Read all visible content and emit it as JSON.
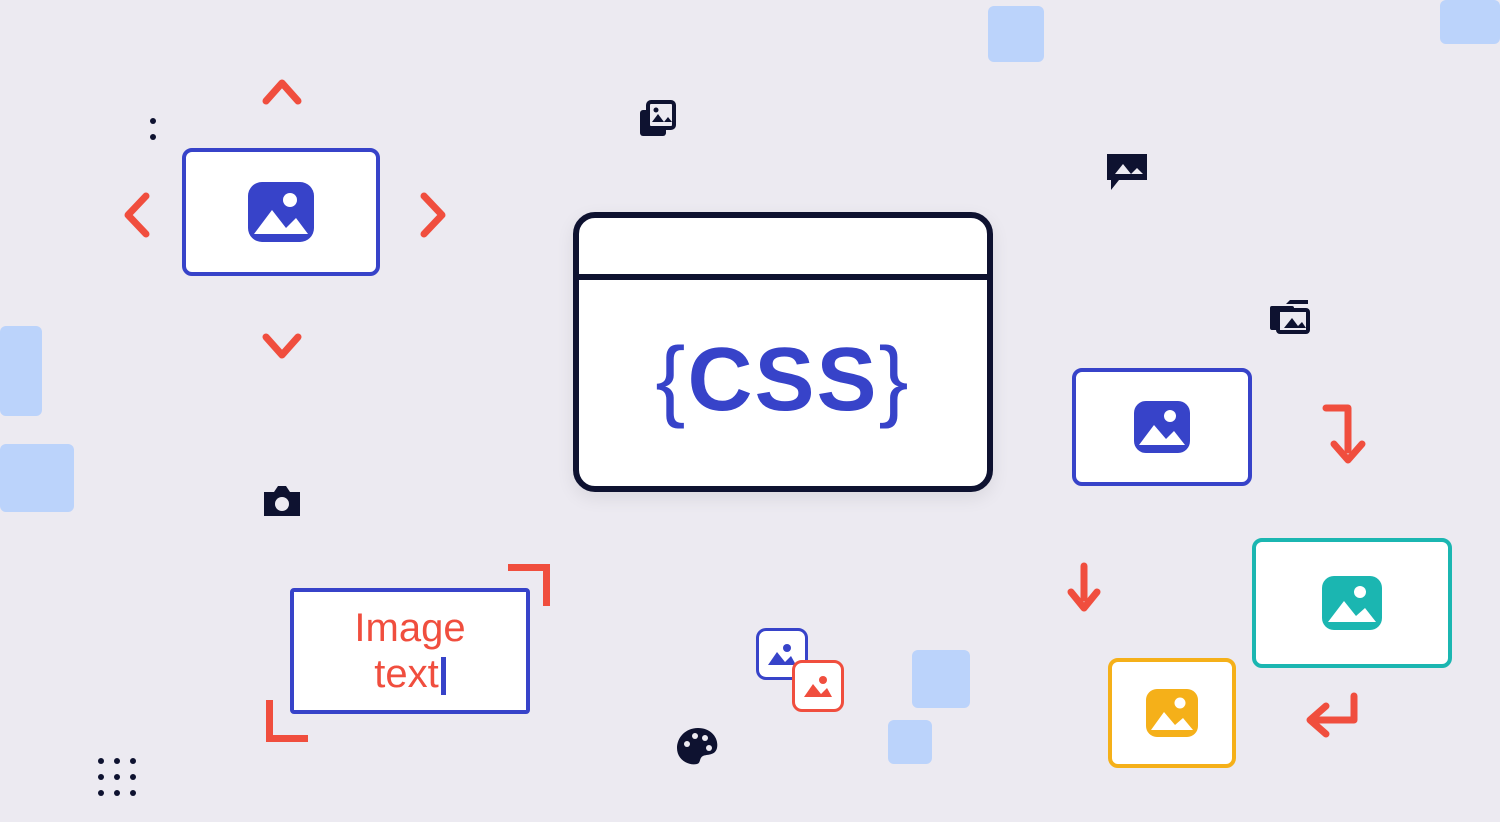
{
  "center": {
    "label": "CSS"
  },
  "image_text": {
    "line1": "Image",
    "line2": "text"
  },
  "icons": {
    "photo_stack": "photo-stack-icon",
    "chat_image": "chat-image-icon",
    "folder_image": "folder-image-icon",
    "camera": "camera-icon",
    "palette": "palette-icon",
    "picture": "picture-icon"
  },
  "colors": {
    "blue": "#3743c9",
    "red": "#f04e3e",
    "navy": "#0e1230",
    "teal": "#1bb6b1",
    "yellow": "#f5b019",
    "pale_blue": "#bbd3fb",
    "bg": "#eceaf1"
  }
}
